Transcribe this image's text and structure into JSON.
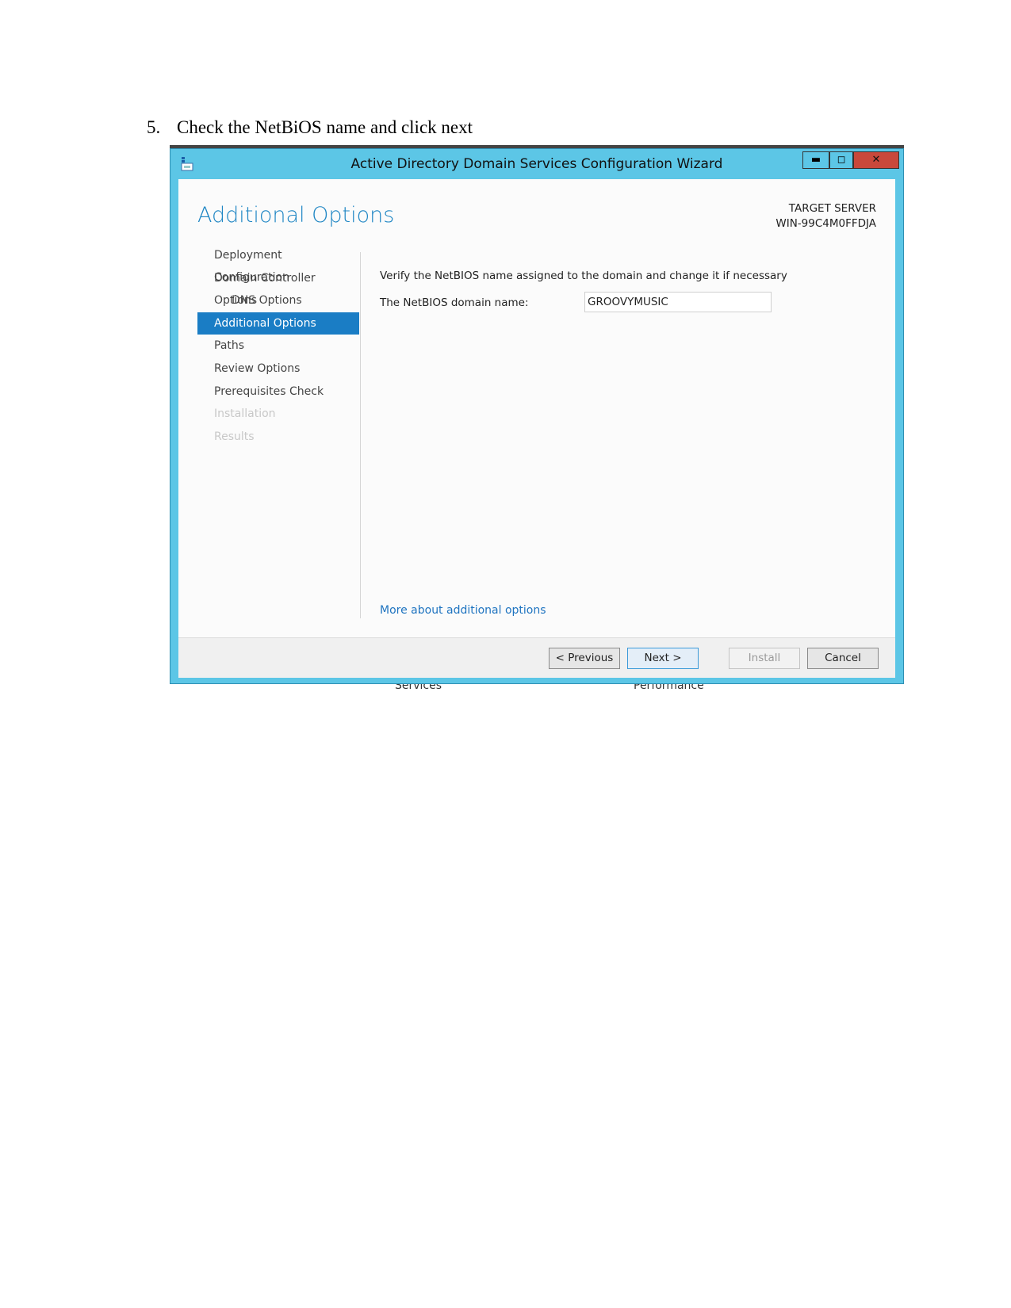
{
  "document": {
    "step_number": "5.",
    "step_text": "Check the NetBiOS name and click next"
  },
  "background_remnants": [
    "Services",
    "Performance"
  ],
  "window": {
    "title": "Active Directory Domain Services Configuration Wizard",
    "controls": {
      "minimize": "▬",
      "maximize": "◻",
      "close": "✕"
    },
    "page_title": "Additional Options",
    "target_server_label": "TARGET SERVER",
    "target_server": "WIN-99C4M0FFDJA",
    "nav": [
      {
        "label": "Deployment Configuration",
        "state": "normal"
      },
      {
        "label": "Domain Controller Options",
        "state": "normal"
      },
      {
        "label": "DNS Options",
        "state": "indent"
      },
      {
        "label": "Additional Options",
        "state": "selected"
      },
      {
        "label": "Paths",
        "state": "normal"
      },
      {
        "label": "Review Options",
        "state": "normal"
      },
      {
        "label": "Prerequisites Check",
        "state": "normal"
      },
      {
        "label": "Installation",
        "state": "disabled"
      },
      {
        "label": "Results",
        "state": "disabled"
      }
    ],
    "verify_text": "Verify the NetBIOS name assigned to the domain and change it if necessary",
    "netbios_label": "The NetBIOS domain name:",
    "netbios_value": "GROOVYMUSIC",
    "more_link": "More about additional options",
    "buttons": {
      "previous": "< Previous",
      "next": "Next >",
      "install": "Install",
      "cancel": "Cancel"
    },
    "colors": {
      "frame": "#5cc6e6",
      "accent": "#1a7dc5",
      "close": "#c9483b"
    }
  }
}
